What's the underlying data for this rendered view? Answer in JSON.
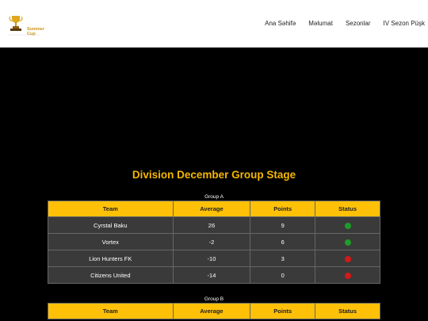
{
  "header": {
    "logo_line1": "Summer",
    "logo_line2": "Cup",
    "nav": [
      "Ana Səhifə",
      "Məlumat",
      "Sezonlar",
      "IV Sezon Püşk"
    ]
  },
  "page": {
    "title": "Division December Group Stage"
  },
  "colors": {
    "accent": "#f5b700",
    "header_bg": "#ffc107",
    "status_qualified": "#1f9d2a",
    "status_eliminated": "#d11a1a"
  },
  "groups": [
    {
      "name": "Group A",
      "columns": [
        "Team",
        "Average",
        "Points",
        "Status"
      ],
      "rows": [
        {
          "team": "Cyrstal Baku",
          "average": "26",
          "points": "9",
          "status": "qualified"
        },
        {
          "team": "Vortex",
          "average": "-2",
          "points": "6",
          "status": "qualified"
        },
        {
          "team": "Lion Hunters FK",
          "average": "-10",
          "points": "3",
          "status": "eliminated"
        },
        {
          "team": "Citizens United",
          "average": "-14",
          "points": "0",
          "status": "eliminated"
        }
      ]
    },
    {
      "name": "Group B",
      "columns": [
        "Team",
        "Average",
        "Points",
        "Status"
      ],
      "rows": []
    }
  ]
}
